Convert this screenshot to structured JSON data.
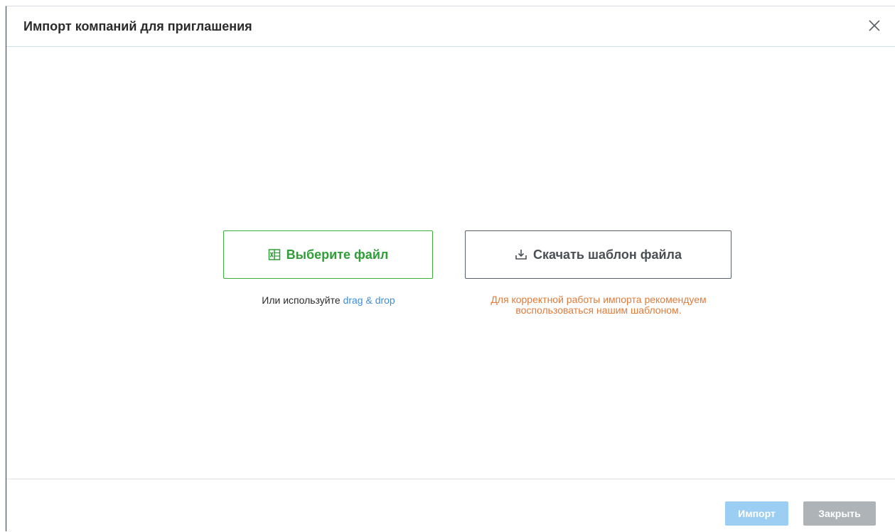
{
  "dialog": {
    "title": "Импорт компаний для приглашения",
    "close_icon": "close-icon"
  },
  "upload": {
    "choose_file_label": "Выберите файл",
    "choose_file_icon": "excel-file-icon",
    "hint_prefix": "Или используйте ",
    "hint_link": "drag & drop"
  },
  "template": {
    "download_label": "Скачать шаблон файла",
    "download_icon": "download-icon",
    "recommend_line1": "Для корректной работы импорта рекомендуем",
    "recommend_line2": "воспользоваться нашим шаблоном."
  },
  "footer": {
    "import_label": "Импорт",
    "close_label": "Закрыть"
  },
  "colors": {
    "choose_accent": "#2f9e36",
    "link": "#3c8dde",
    "warning_text": "#e07b39",
    "import_disabled": "#9ccdf3",
    "close_disabled": "#aeb3b8"
  }
}
